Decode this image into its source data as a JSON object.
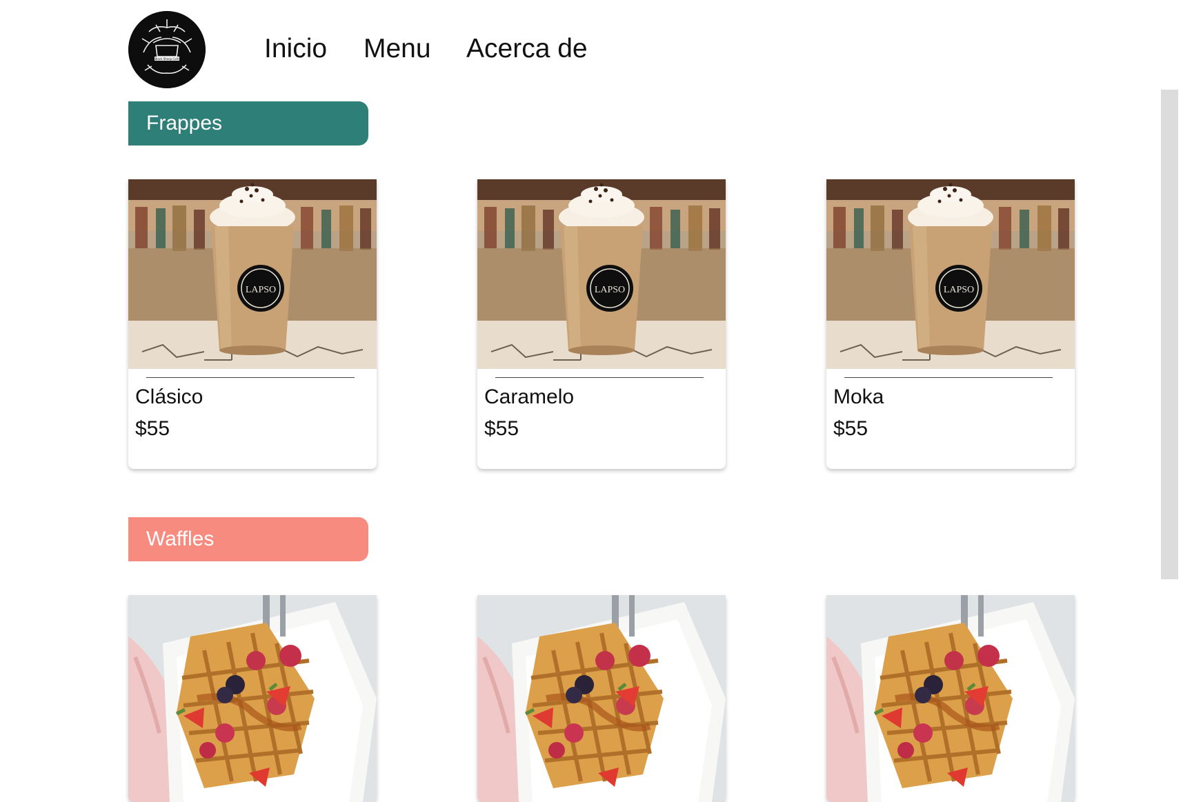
{
  "nav": {
    "logo_icon": "cafe-logo-icon",
    "links": [
      "Inicio",
      "Menu",
      "Acerca de"
    ]
  },
  "sections": [
    {
      "title": "Frappes",
      "color": "#2f7f79",
      "items": [
        {
          "name": "Clásico",
          "price": "$55"
        },
        {
          "name": "Caramelo",
          "price": "$55"
        },
        {
          "name": "Moka",
          "price": "$55"
        }
      ]
    },
    {
      "title": "Waffles",
      "color": "#f88b80",
      "items": [
        {},
        {},
        {}
      ]
    }
  ]
}
